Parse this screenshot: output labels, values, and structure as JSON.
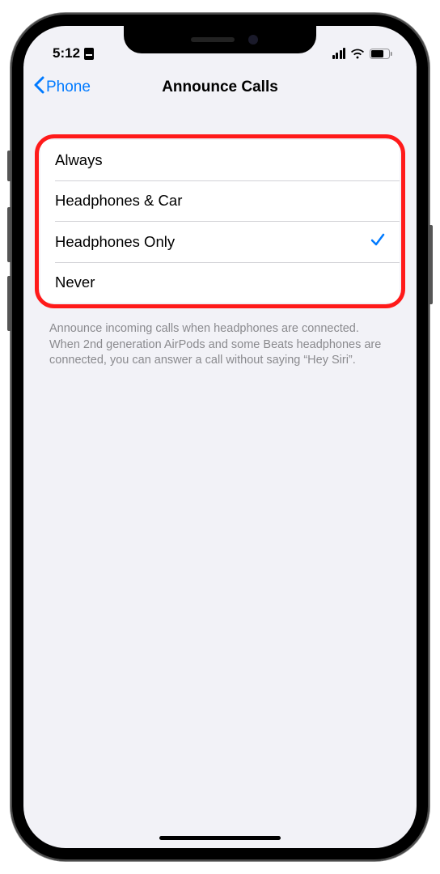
{
  "status": {
    "time": "5:12"
  },
  "nav": {
    "back_label": "Phone",
    "title": "Announce Calls"
  },
  "options": [
    {
      "label": "Always",
      "selected": false
    },
    {
      "label": "Headphones & Car",
      "selected": false
    },
    {
      "label": "Headphones Only",
      "selected": true
    },
    {
      "label": "Never",
      "selected": false
    }
  ],
  "footer": "Announce incoming calls when headphones are connected. When 2nd generation AirPods and some Beats headphones are connected, you can answer a call without saying “Hey Siri”."
}
